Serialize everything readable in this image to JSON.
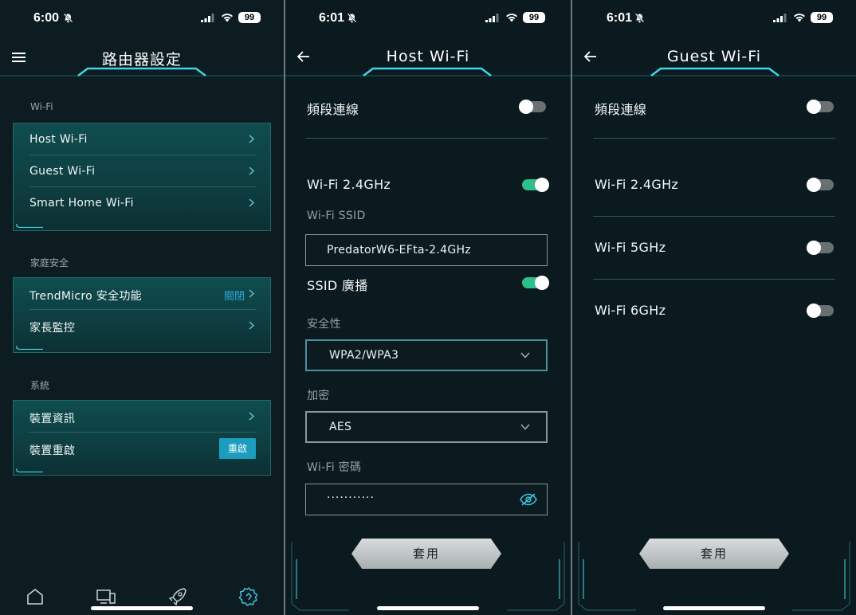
{
  "status_bar": [
    {
      "time": "6:00",
      "battery": "99"
    },
    {
      "time": "6:01",
      "battery": "99"
    },
    {
      "time": "6:01",
      "battery": "99"
    }
  ],
  "router_settings": {
    "title": "路由器設定",
    "sections": [
      {
        "label": "Wi-Fi",
        "items": [
          {
            "label": "Host Wi-Fi"
          },
          {
            "label": "Guest Wi-Fi"
          },
          {
            "label": "Smart Home Wi-Fi"
          }
        ]
      },
      {
        "label": "家庭安全",
        "items": [
          {
            "label": "TrendMicro 安全功能",
            "status": "關閉"
          },
          {
            "label": "家長監控"
          }
        ]
      },
      {
        "label": "系統",
        "items": [
          {
            "label": "裝置資訊"
          },
          {
            "label": "裝置重啟",
            "button": "重啟"
          }
        ]
      }
    ],
    "bottom_nav": [
      "home-icon",
      "devices-icon",
      "rocket-icon",
      "settings-gear-icon"
    ],
    "active_nav": 3
  },
  "host_wifi": {
    "title": "Host Wi-Fi",
    "band_steering_label": "頻段連線",
    "band_steering_on": false,
    "band_label": "Wi-Fi 2.4GHz",
    "band_on": true,
    "ssid_label": "Wi-Fi SSID",
    "ssid_value": "PredatorW6-EFta-2.4GHz",
    "ssid_broadcast_label": "SSID 廣播",
    "ssid_broadcast_on": true,
    "security_label": "安全性",
    "security_value": "WPA2/WPA3",
    "encryption_label": "加密",
    "encryption_value": "AES",
    "password_label": "Wi-Fi 密碼",
    "password_value": "···········",
    "apply_label": "套用"
  },
  "guest_wifi": {
    "title": "Guest Wi-Fi",
    "band_steering_label": "頻段連線",
    "band_steering_on": false,
    "bands": [
      {
        "label": "Wi-Fi 2.4GHz",
        "on": false
      },
      {
        "label": "Wi-Fi 5GHz",
        "on": false
      },
      {
        "label": "Wi-Fi 6GHz",
        "on": false
      }
    ],
    "apply_label": "套用"
  },
  "colors": {
    "accent_teal": "#1f6a6c",
    "toggle_on": "#2fbf8a",
    "link_blue": "#2aa6d8",
    "button_blue": "#1c9dbf"
  }
}
